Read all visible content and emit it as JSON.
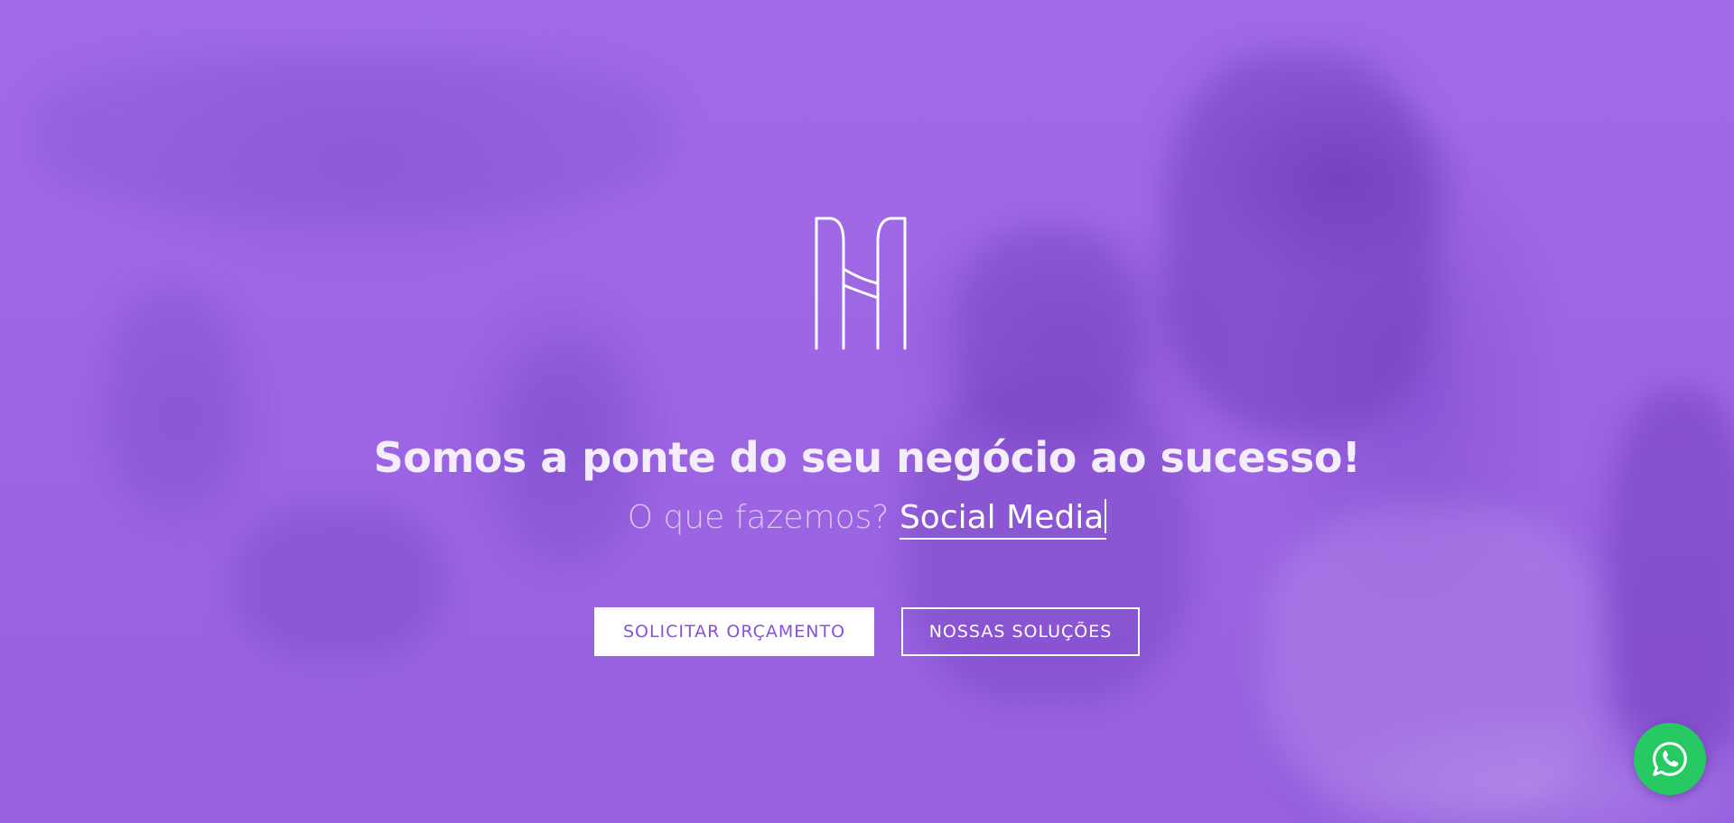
{
  "hero": {
    "headline": "Somos a ponte do seu negócio ao sucesso!",
    "subtitle_prefix": "O que fazemos?",
    "subtitle_typed": "Social Media",
    "overlay_color": "#9b63e0"
  },
  "actions": {
    "primary_label": "SOLICITAR ORÇAMENTO",
    "secondary_label": "NOSSAS SOLUÇÕES"
  },
  "floating": {
    "whatsapp_icon": "whatsapp-icon",
    "whatsapp_color": "#27c963"
  },
  "brand": {
    "logo_icon": "bridge-logo-icon"
  }
}
